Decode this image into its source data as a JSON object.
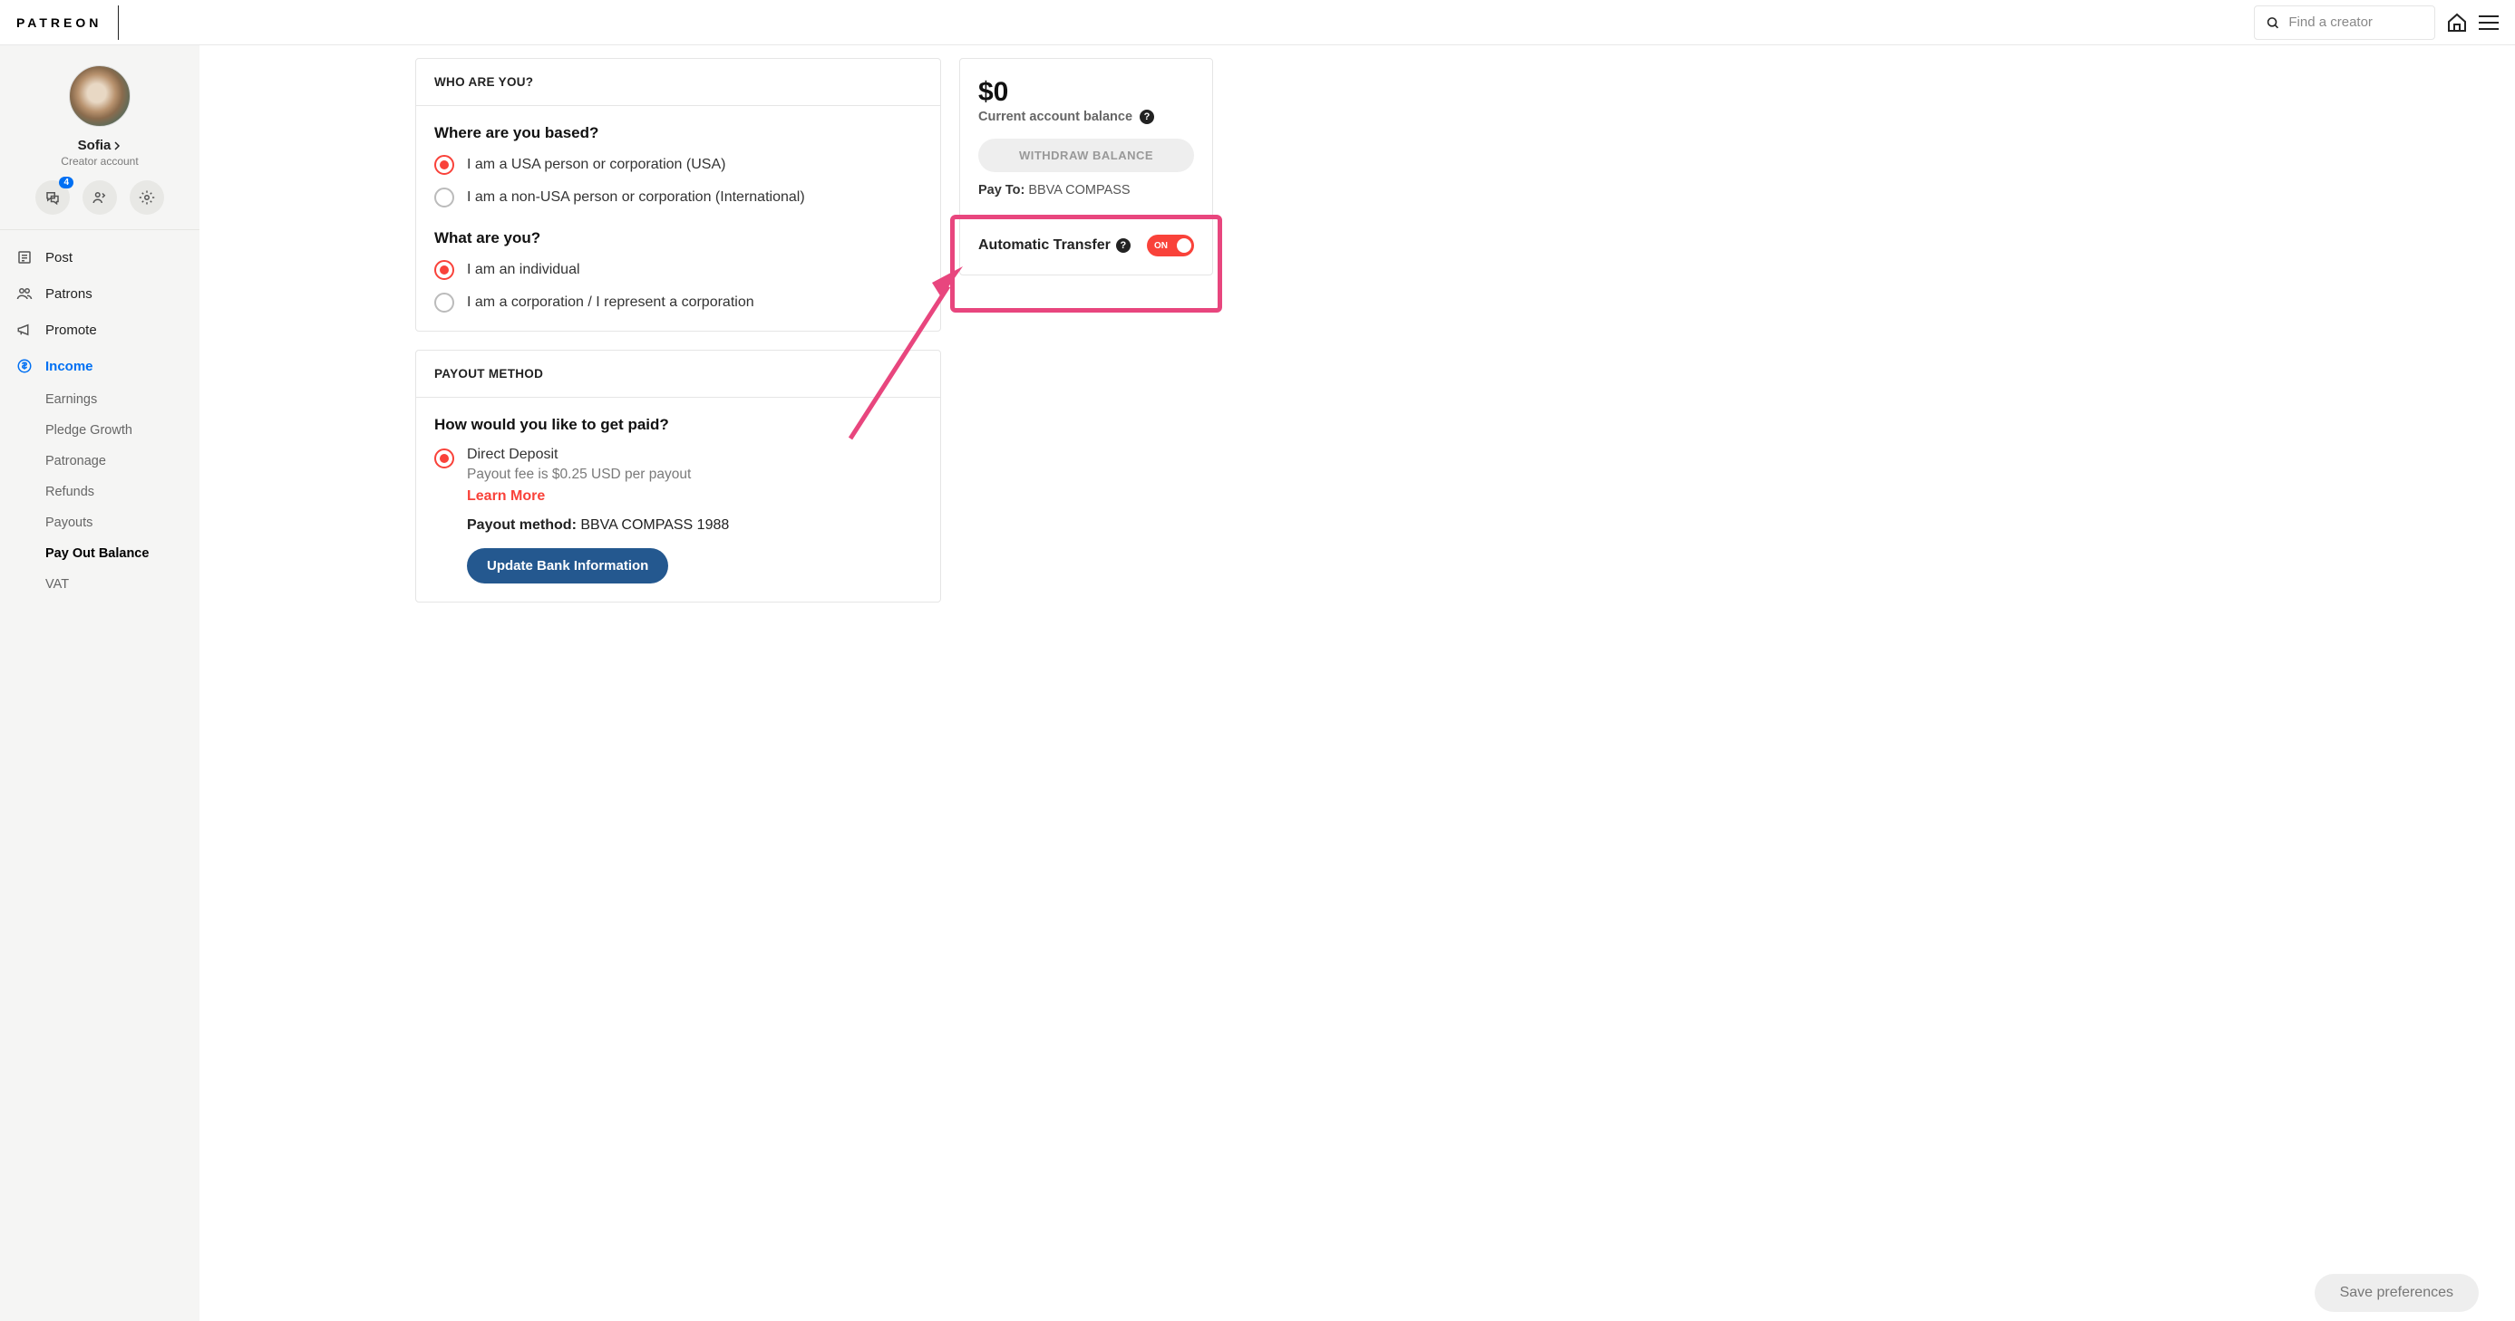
{
  "header": {
    "logo": "PATREON",
    "search_placeholder": "Find a creator"
  },
  "profile": {
    "name": "Sofia",
    "subtitle": "Creator account",
    "badge_count": "4"
  },
  "nav": {
    "post": "Post",
    "patrons": "Patrons",
    "promote": "Promote",
    "income": "Income"
  },
  "subnav": {
    "earnings": "Earnings",
    "pledge_growth": "Pledge Growth",
    "patronage": "Patronage",
    "refunds": "Refunds",
    "payouts": "Payouts",
    "payout_balance": "Pay Out Balance",
    "vat": "VAT"
  },
  "who": {
    "heading": "WHO ARE YOU?",
    "q1": "Where are you based?",
    "q1_opt1": "I am a USA person or corporation (USA)",
    "q1_opt2": "I am a non-USA person or corporation (International)",
    "q2": "What are you?",
    "q2_opt1": "I am an individual",
    "q2_opt2": "I am a corporation / I represent a corporation"
  },
  "payout": {
    "heading": "PAYOUT METHOD",
    "q": "How would you like to get paid?",
    "opt1": "Direct Deposit",
    "opt1_fee": "Payout fee is $0.25 USD per payout",
    "learn_more": "Learn More",
    "method_label": "Payout method:",
    "method_value": " BBVA COMPASS 1988",
    "update_btn": "Update Bank Information"
  },
  "balance": {
    "amount": "$0",
    "label": "Current account balance",
    "withdraw": "WITHDRAW BALANCE",
    "payto_label": "Pay To:",
    "payto_value": " BBVA COMPASS",
    "auto_transfer": "Automatic Transfer",
    "toggle": "ON"
  },
  "footer": {
    "save": "Save preferences"
  }
}
